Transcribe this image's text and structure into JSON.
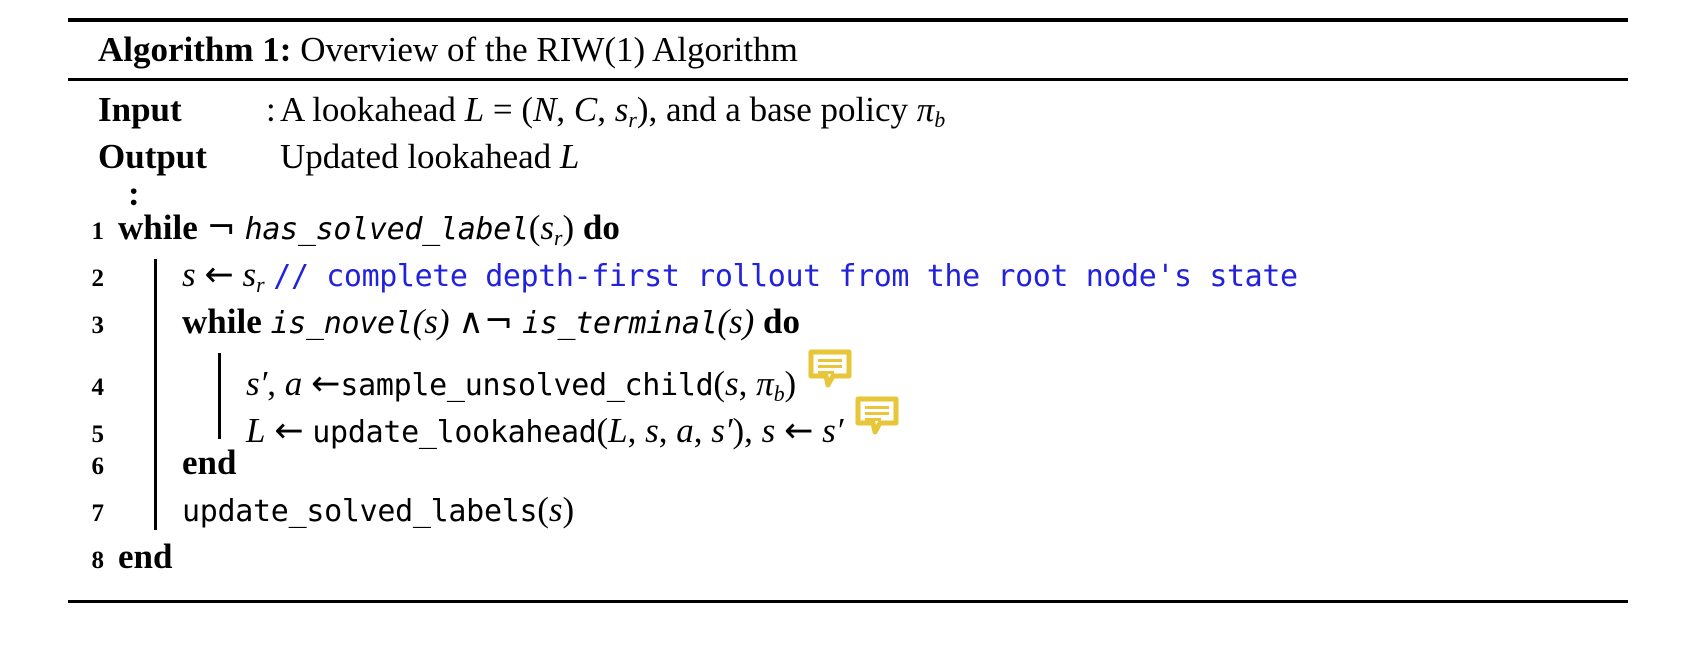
{
  "caption": {
    "label": "Algorithm 1:",
    "title": "Overview of the RIW(1) Algorithm"
  },
  "io": {
    "input_key": "Input",
    "input_colon": ":",
    "input_value_pre": "A lookahead ",
    "input_value_L": "L",
    "input_value_eq": " = (",
    "input_value_N": "N",
    "input_value_comma1": ", ",
    "input_value_C": "C",
    "input_value_comma2": ", ",
    "input_value_s": "s",
    "input_value_s_sub": "r",
    "input_value_post": "), and a base policy ",
    "input_value_pi": "π",
    "input_value_pi_sub": "b",
    "output_key": "Output",
    "output_value_pre": "Updated lookahead ",
    "output_value_L": "L",
    "stray_colon": ":"
  },
  "lines": [
    {
      "no": "1",
      "kw_while": "while",
      "neg": "¬",
      "fn": "has_solved_label",
      "arg_open": "(",
      "arg_s": "s",
      "arg_sub": "r",
      "arg_close": ")",
      "kw_do": "do"
    },
    {
      "no": "2",
      "var_s": "s",
      "arrow": "←",
      "var_sr": "s",
      "var_sr_sub": "r",
      "comment": "// complete depth-first rollout from the root node's state"
    },
    {
      "no": "3",
      "kw_while": "while",
      "fn1": "is_novel",
      "fn1_args": "(s)",
      "and": "∧",
      "neg": "¬",
      "fn2": "is_terminal",
      "fn2_args": "(s)",
      "kw_do": "do"
    },
    {
      "no": "4",
      "lhs_s": "s",
      "lhs_prime": "′",
      "lhs_comma": ", ",
      "lhs_a": "a",
      "arrow": "←",
      "fn": "sample_unsolved_child",
      "arg_open": "(",
      "arg_s": "s",
      "arg_comma": ", ",
      "arg_pi": "π",
      "arg_pi_sub": "b",
      "arg_close": ")",
      "icon": "comment-bubble-icon"
    },
    {
      "no": "5",
      "lhs_L": "L",
      "arrow": "←",
      "fn": "update_lookahead",
      "arg_open": "(",
      "arg_L": "L",
      "arg_c1": ", ",
      "arg_s": "s",
      "arg_c2": ", ",
      "arg_a": "a",
      "arg_c3": ", ",
      "arg_sp": "s",
      "arg_sp_prime": "′",
      "arg_close": ")",
      "tail_comma": ", ",
      "tail_s": "s",
      "tail_arrow": "←",
      "tail_sp": "s",
      "tail_sp_prime": "′",
      "icon": "comment-bubble-icon"
    },
    {
      "no": "6",
      "kw_end": "end"
    },
    {
      "no": "7",
      "fn": "update_solved_labels",
      "arg_open": "(",
      "arg_s": "s",
      "arg_close": ")"
    },
    {
      "no": "8",
      "kw_end": "end"
    }
  ],
  "colors": {
    "comment_blue": "#2222dd",
    "bubble_gold": "#e8c63a",
    "bubble_fill": "#ffffff",
    "rule_black": "#000000"
  }
}
